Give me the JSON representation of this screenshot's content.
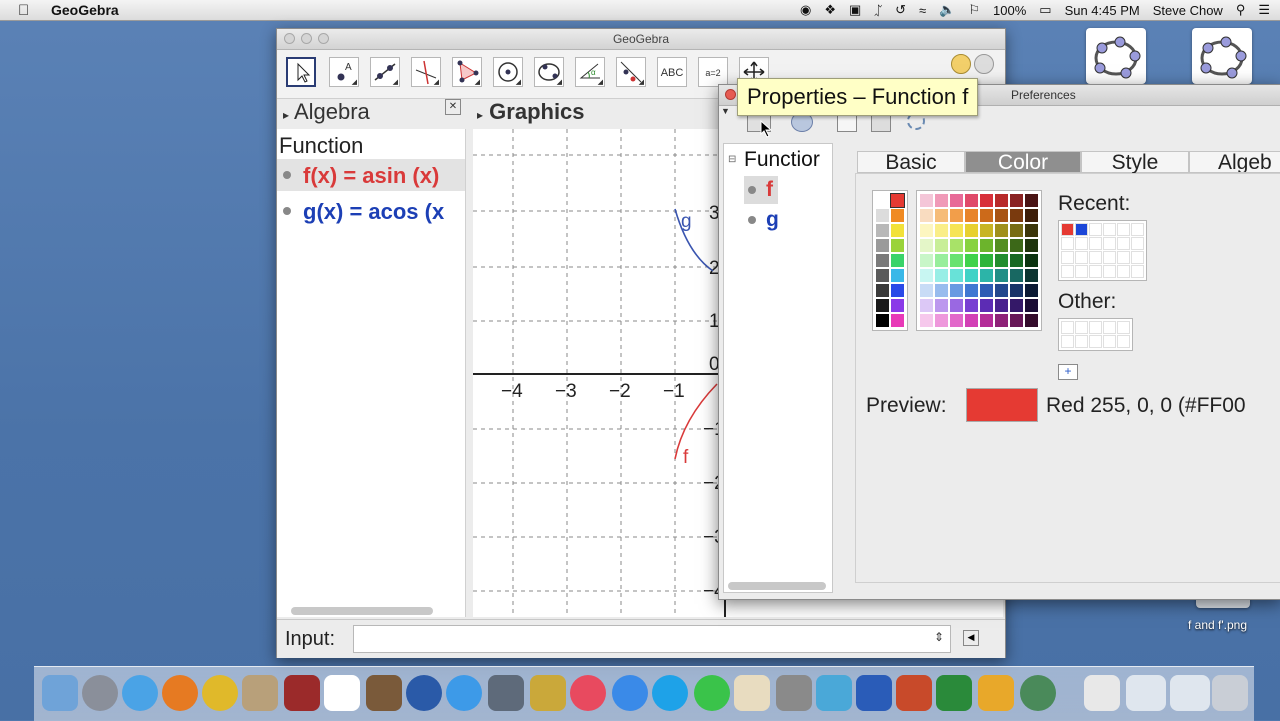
{
  "menubar": {
    "app_name": "GeoGebra",
    "battery": "100%",
    "clock": "Sun 4:45 PM",
    "user": "Steve Chow"
  },
  "desktop": {
    "file_label": "f and f'.png"
  },
  "main_window": {
    "title": "GeoGebra",
    "tools": [
      "move",
      "point",
      "line",
      "perpendicular",
      "polygon",
      "circle",
      "conic",
      "angle",
      "reflect",
      "ABC",
      "a=2",
      "move-graphics"
    ],
    "tool_abc_label": "ABC",
    "tool_slider_label": "a=2",
    "algebra_title": "Algebra",
    "graphics_title": "Graphics",
    "algebra_group": "Function",
    "functions": [
      {
        "name": "f(x) = asin (x)",
        "color": "#d93a3a"
      },
      {
        "name": "g(x) = acos (x",
        "color": "#1c3fb5"
      }
    ],
    "input_label": "Input:"
  },
  "graph": {
    "x_ticks": [
      "−4",
      "−3",
      "−2",
      "−1"
    ],
    "y_ticks": [
      "3",
      "2",
      "1",
      "0",
      "−1",
      "−2",
      "−3",
      "−4"
    ],
    "curve_labels": {
      "f": "f",
      "g": "g"
    },
    "colors": {
      "f": "#d93a3a",
      "g": "#3a55b0"
    }
  },
  "properties_window": {
    "title_right": "Preferences",
    "tooltip": "Properties – Function f",
    "tree_group": "Functior",
    "tree_items": [
      {
        "label": "f",
        "color": "#d93a3a"
      },
      {
        "label": "g",
        "color": "#1c3fb5"
      }
    ],
    "tabs": [
      "Basic",
      "Color",
      "Style",
      "Algeb"
    ],
    "active_tab": "Color",
    "recent_label": "Recent:",
    "other_label": "Other:",
    "preview_label": "Preview:",
    "preview_color": "#e53a33",
    "preview_value": "Red 255, 0, 0 (#FF00",
    "recent_colors": [
      "#e53a33",
      "#1c47d8"
    ]
  }
}
